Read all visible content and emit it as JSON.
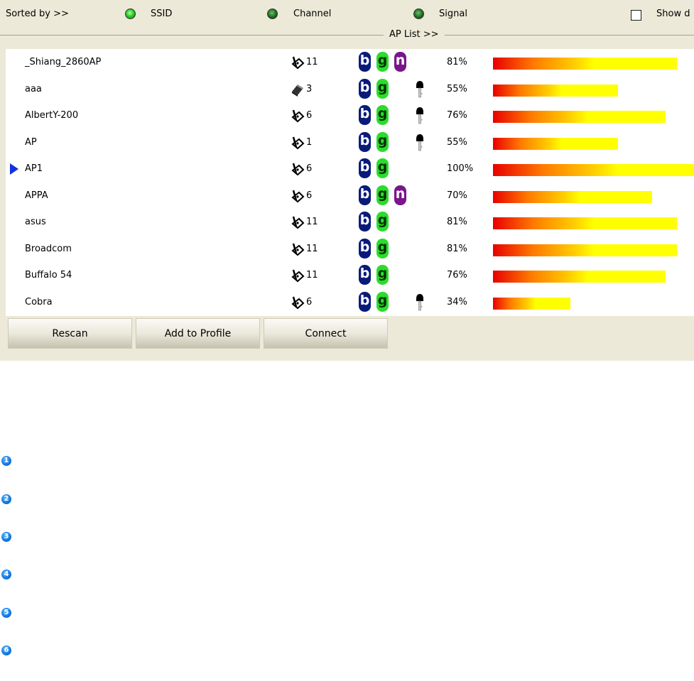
{
  "sort_bar": {
    "label": "Sorted by >>",
    "options": [
      {
        "label": "SSID",
        "selected": true
      },
      {
        "label": "Channel",
        "selected": false
      },
      {
        "label": "Signal",
        "selected": false
      }
    ],
    "show_label": "Show d"
  },
  "list_title": "AP List >>",
  "access_points": [
    {
      "ssid": "_Shiang_2860AP",
      "channel": "11",
      "channel_icon": "infrastructure-icon",
      "modes": [
        "b",
        "g",
        "n"
      ],
      "secured": false,
      "signal": "81%",
      "signal_fraction": 0.81,
      "selected": false
    },
    {
      "ssid": "aaa",
      "channel": "3",
      "channel_icon": "adhoc-icon",
      "modes": [
        "b",
        "g"
      ],
      "secured": true,
      "signal": "55%",
      "signal_fraction": 0.55,
      "selected": false
    },
    {
      "ssid": "AlbertY-200",
      "channel": "6",
      "channel_icon": "infrastructure-icon",
      "modes": [
        "b",
        "g"
      ],
      "secured": true,
      "signal": "76%",
      "signal_fraction": 0.76,
      "selected": false
    },
    {
      "ssid": "AP",
      "channel": "1",
      "channel_icon": "infrastructure-icon",
      "modes": [
        "b",
        "g"
      ],
      "secured": true,
      "signal": "55%",
      "signal_fraction": 0.55,
      "selected": false
    },
    {
      "ssid": "AP1",
      "channel": "6",
      "channel_icon": "infrastructure-icon",
      "modes": [
        "b",
        "g"
      ],
      "secured": false,
      "signal": "100%",
      "signal_fraction": 1.0,
      "selected": true
    },
    {
      "ssid": "APPA",
      "channel": "6",
      "channel_icon": "infrastructure-icon",
      "modes": [
        "b",
        "g",
        "n"
      ],
      "secured": false,
      "signal": "70%",
      "signal_fraction": 0.7,
      "selected": false
    },
    {
      "ssid": "asus",
      "channel": "11",
      "channel_icon": "infrastructure-icon",
      "modes": [
        "b",
        "g"
      ],
      "secured": false,
      "signal": "81%",
      "signal_fraction": 0.81,
      "selected": false
    },
    {
      "ssid": "Broadcom",
      "channel": "11",
      "channel_icon": "infrastructure-icon",
      "modes": [
        "b",
        "g"
      ],
      "secured": false,
      "signal": "81%",
      "signal_fraction": 0.81,
      "selected": false
    },
    {
      "ssid": "Buffalo 54",
      "channel": "11",
      "channel_icon": "infrastructure-icon",
      "modes": [
        "b",
        "g"
      ],
      "secured": false,
      "signal": "76%",
      "signal_fraction": 0.76,
      "selected": false
    },
    {
      "ssid": "Cobra",
      "channel": "6",
      "channel_icon": "infrastructure-icon",
      "modes": [
        "b",
        "g"
      ],
      "secured": true,
      "signal": "34%",
      "signal_fraction": 0.34,
      "selected": false
    }
  ],
  "buttons": {
    "rescan": "Rescan",
    "add_to_profile": "Add to Profile",
    "connect": "Connect"
  },
  "callouts": [
    "1",
    "2",
    "3",
    "4",
    "5",
    "6"
  ],
  "colors": {
    "panel_bg": "#ece9d8",
    "badge_b": "#0a1a7a",
    "badge_g": "#2cdc2c",
    "badge_n": "#7a168a",
    "selection_arrow": "#1030e0",
    "callout": "#0a6cd8"
  }
}
